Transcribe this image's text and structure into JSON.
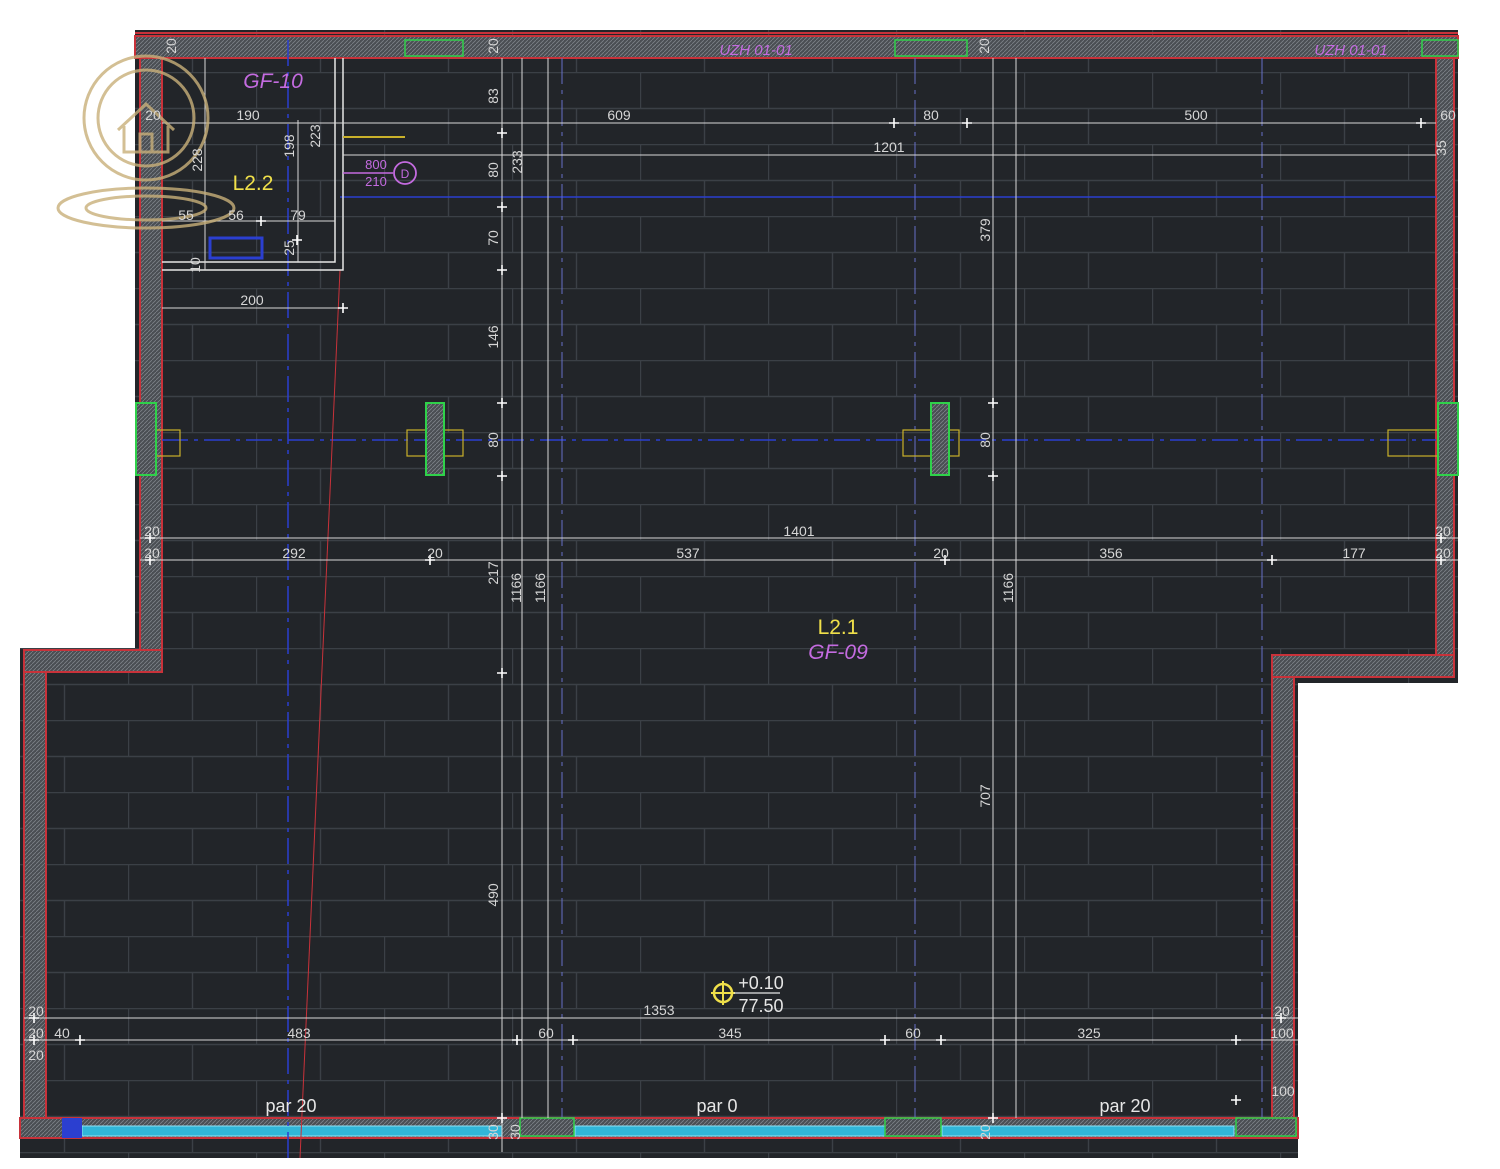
{
  "colors": {
    "floor": "#222529",
    "tile_line": "#3b4046",
    "wall_outline": "#c8323a",
    "wall_fill": "#4a4e53",
    "dim_line": "#d8d8d8",
    "axis_blue": "#2b3fd0",
    "column_green": "#2fd14a",
    "window_cyan": "#31b6d8",
    "label_yellow": "#f0e04a",
    "label_magenta": "#c46be0"
  },
  "rooms": {
    "main_code": "L2.1",
    "main_name": "GF-09",
    "small_code": "L2.2",
    "small_name": "GF-10"
  },
  "section_labels": [
    "UZH 01-01",
    "UZH 01-01"
  ],
  "door": {
    "width": "800",
    "height": "210",
    "tag": "D"
  },
  "level": {
    "relative": "+0.10",
    "absolute": "77.50"
  },
  "parapets": [
    "par 20",
    "par 0",
    "par 20"
  ],
  "dimensions": {
    "top_row": [
      "609",
      "80",
      "500",
      "60"
    ],
    "top_overall": "1201",
    "right_small": "35",
    "small_room_h": [
      "20",
      "190",
      "223",
      "198",
      "228"
    ],
    "small_room_w": [
      "55",
      "56",
      "79"
    ],
    "small_room_misc": [
      "25",
      "10",
      "200"
    ],
    "left_vertical": [
      "83",
      "80",
      "70",
      "146",
      "80",
      "217",
      "490"
    ],
    "right_vertical": [
      "379",
      "80",
      "707"
    ],
    "vertical_long": [
      "233",
      "1166",
      "1166",
      "1166"
    ],
    "wall_top_marks": [
      "20",
      "20",
      "20"
    ],
    "mid_overall": "1401",
    "mid_row": [
      "20",
      "20",
      "292",
      "20",
      "537",
      "20",
      "356",
      "177",
      "20",
      "20"
    ],
    "bottom_overall": "1353",
    "bottom_row": [
      "20",
      "20",
      "40",
      "483",
      "60",
      "345",
      "60",
      "325",
      "100",
      "20",
      "20"
    ],
    "bottom_misc": [
      "100",
      "30",
      "30",
      "20"
    ]
  }
}
